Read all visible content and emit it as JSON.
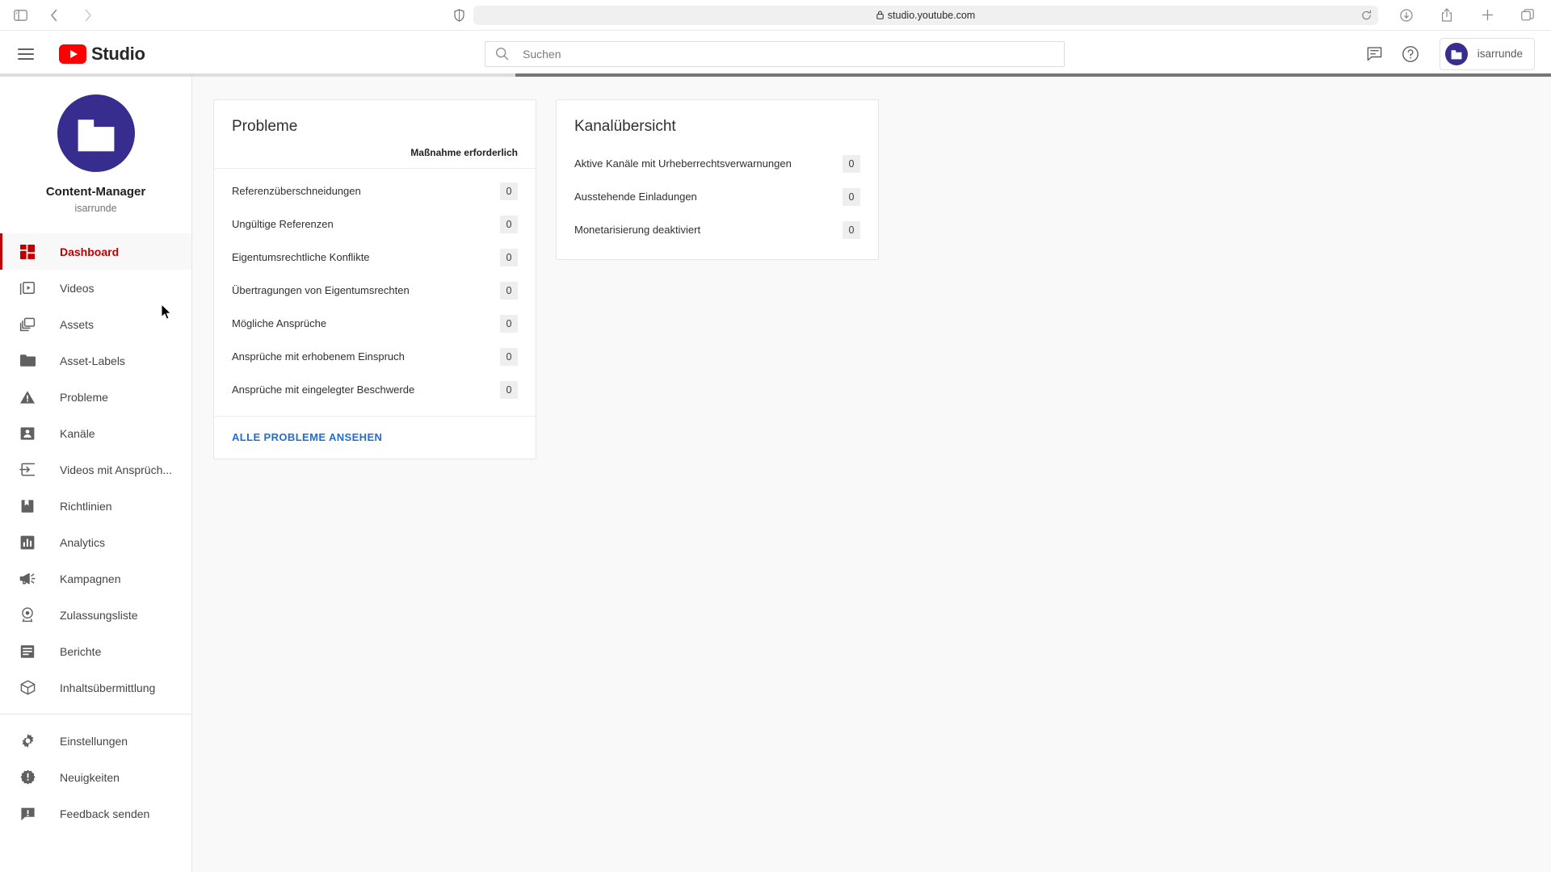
{
  "browser": {
    "url": "studio.youtube.com",
    "toolbar_left": [
      {
        "name": "sidebar-toggle-icon",
        "label": "Sidebar"
      },
      {
        "name": "back-icon",
        "label": "Back"
      },
      {
        "name": "forward-icon",
        "label": "Forward"
      }
    ],
    "toolbar_right": [
      {
        "name": "downloads-icon",
        "label": "Downloads"
      },
      {
        "name": "share-icon",
        "label": "Share"
      },
      {
        "name": "new-tab-icon",
        "label": "New Tab"
      },
      {
        "name": "tab-overview-icon",
        "label": "Tab Overview"
      }
    ]
  },
  "header": {
    "logo_text": "Studio",
    "search": {
      "placeholder": "Suchen",
      "value": ""
    },
    "account_name": "isarrunde",
    "icons": {
      "menu": "hamburger-icon",
      "feedback": "feedback-icon",
      "help": "help-icon"
    }
  },
  "sidebar": {
    "channel_title": "Content-Manager",
    "channel_handle": "isarrunde",
    "avatar_icon": "building-icon",
    "active_item": "Dashboard",
    "items": [
      {
        "label": "Dashboard",
        "icon": "dashboard-icon",
        "active": true
      },
      {
        "label": "Videos",
        "icon": "video-icon",
        "active": false
      },
      {
        "label": "Assets",
        "icon": "assets-icon",
        "active": false
      },
      {
        "label": "Asset-Labels",
        "icon": "folder-icon",
        "active": false
      },
      {
        "label": "Probleme",
        "icon": "warning-icon",
        "active": false
      },
      {
        "label": "Kanäle",
        "icon": "person-card-icon",
        "active": false
      },
      {
        "label": "Videos mit Ansprüch...",
        "icon": "claims-icon",
        "active": false
      },
      {
        "label": "Richtlinien",
        "icon": "policy-icon",
        "active": false
      },
      {
        "label": "Analytics",
        "icon": "analytics-icon",
        "active": false
      },
      {
        "label": "Kampagnen",
        "icon": "campaign-icon",
        "active": false
      },
      {
        "label": "Zulassungsliste",
        "icon": "allowlist-icon",
        "active": false
      },
      {
        "label": "Berichte",
        "icon": "reports-icon",
        "active": false
      },
      {
        "label": "Inhaltsübermittlung",
        "icon": "delivery-icon",
        "active": false
      }
    ],
    "footer_items": [
      {
        "label": "Einstellungen",
        "icon": "gear-icon"
      },
      {
        "label": "Neuigkeiten",
        "icon": "whats-new-icon"
      },
      {
        "label": "Feedback senden",
        "icon": "send-feedback-icon"
      }
    ]
  },
  "main": {
    "problems_card": {
      "title": "Probleme",
      "subheader": "Maßnahme erforderlich",
      "rows": [
        {
          "label": "Referenzüberschneidungen",
          "count": "0"
        },
        {
          "label": "Ungültige Referenzen",
          "count": "0"
        },
        {
          "label": "Eigentumsrechtliche Konflikte",
          "count": "0"
        },
        {
          "label": "Übertragungen von Eigentumsrechten",
          "count": "0"
        },
        {
          "label": "Mögliche Ansprüche",
          "count": "0"
        },
        {
          "label": "Ansprüche mit erhobenem Einspruch",
          "count": "0"
        },
        {
          "label": "Ansprüche mit eingelegter Beschwerde",
          "count": "0"
        }
      ],
      "footer_link": "ALLE PROBLEME ANSEHEN"
    },
    "channels_card": {
      "title": "Kanalübersicht",
      "rows": [
        {
          "label": "Aktive Kanäle mit Urheberrechtsverwarnungen",
          "count": "0"
        },
        {
          "label": "Ausstehende Einladungen",
          "count": "0"
        },
        {
          "label": "Monetarisierung deaktiviert",
          "count": "0"
        }
      ]
    }
  },
  "colors": {
    "brand_red": "#ff0000",
    "active_red": "#c00000",
    "avatar_purple": "#372d8f",
    "link_blue": "#1f6fd3",
    "page_bg": "#f9f9f9"
  }
}
